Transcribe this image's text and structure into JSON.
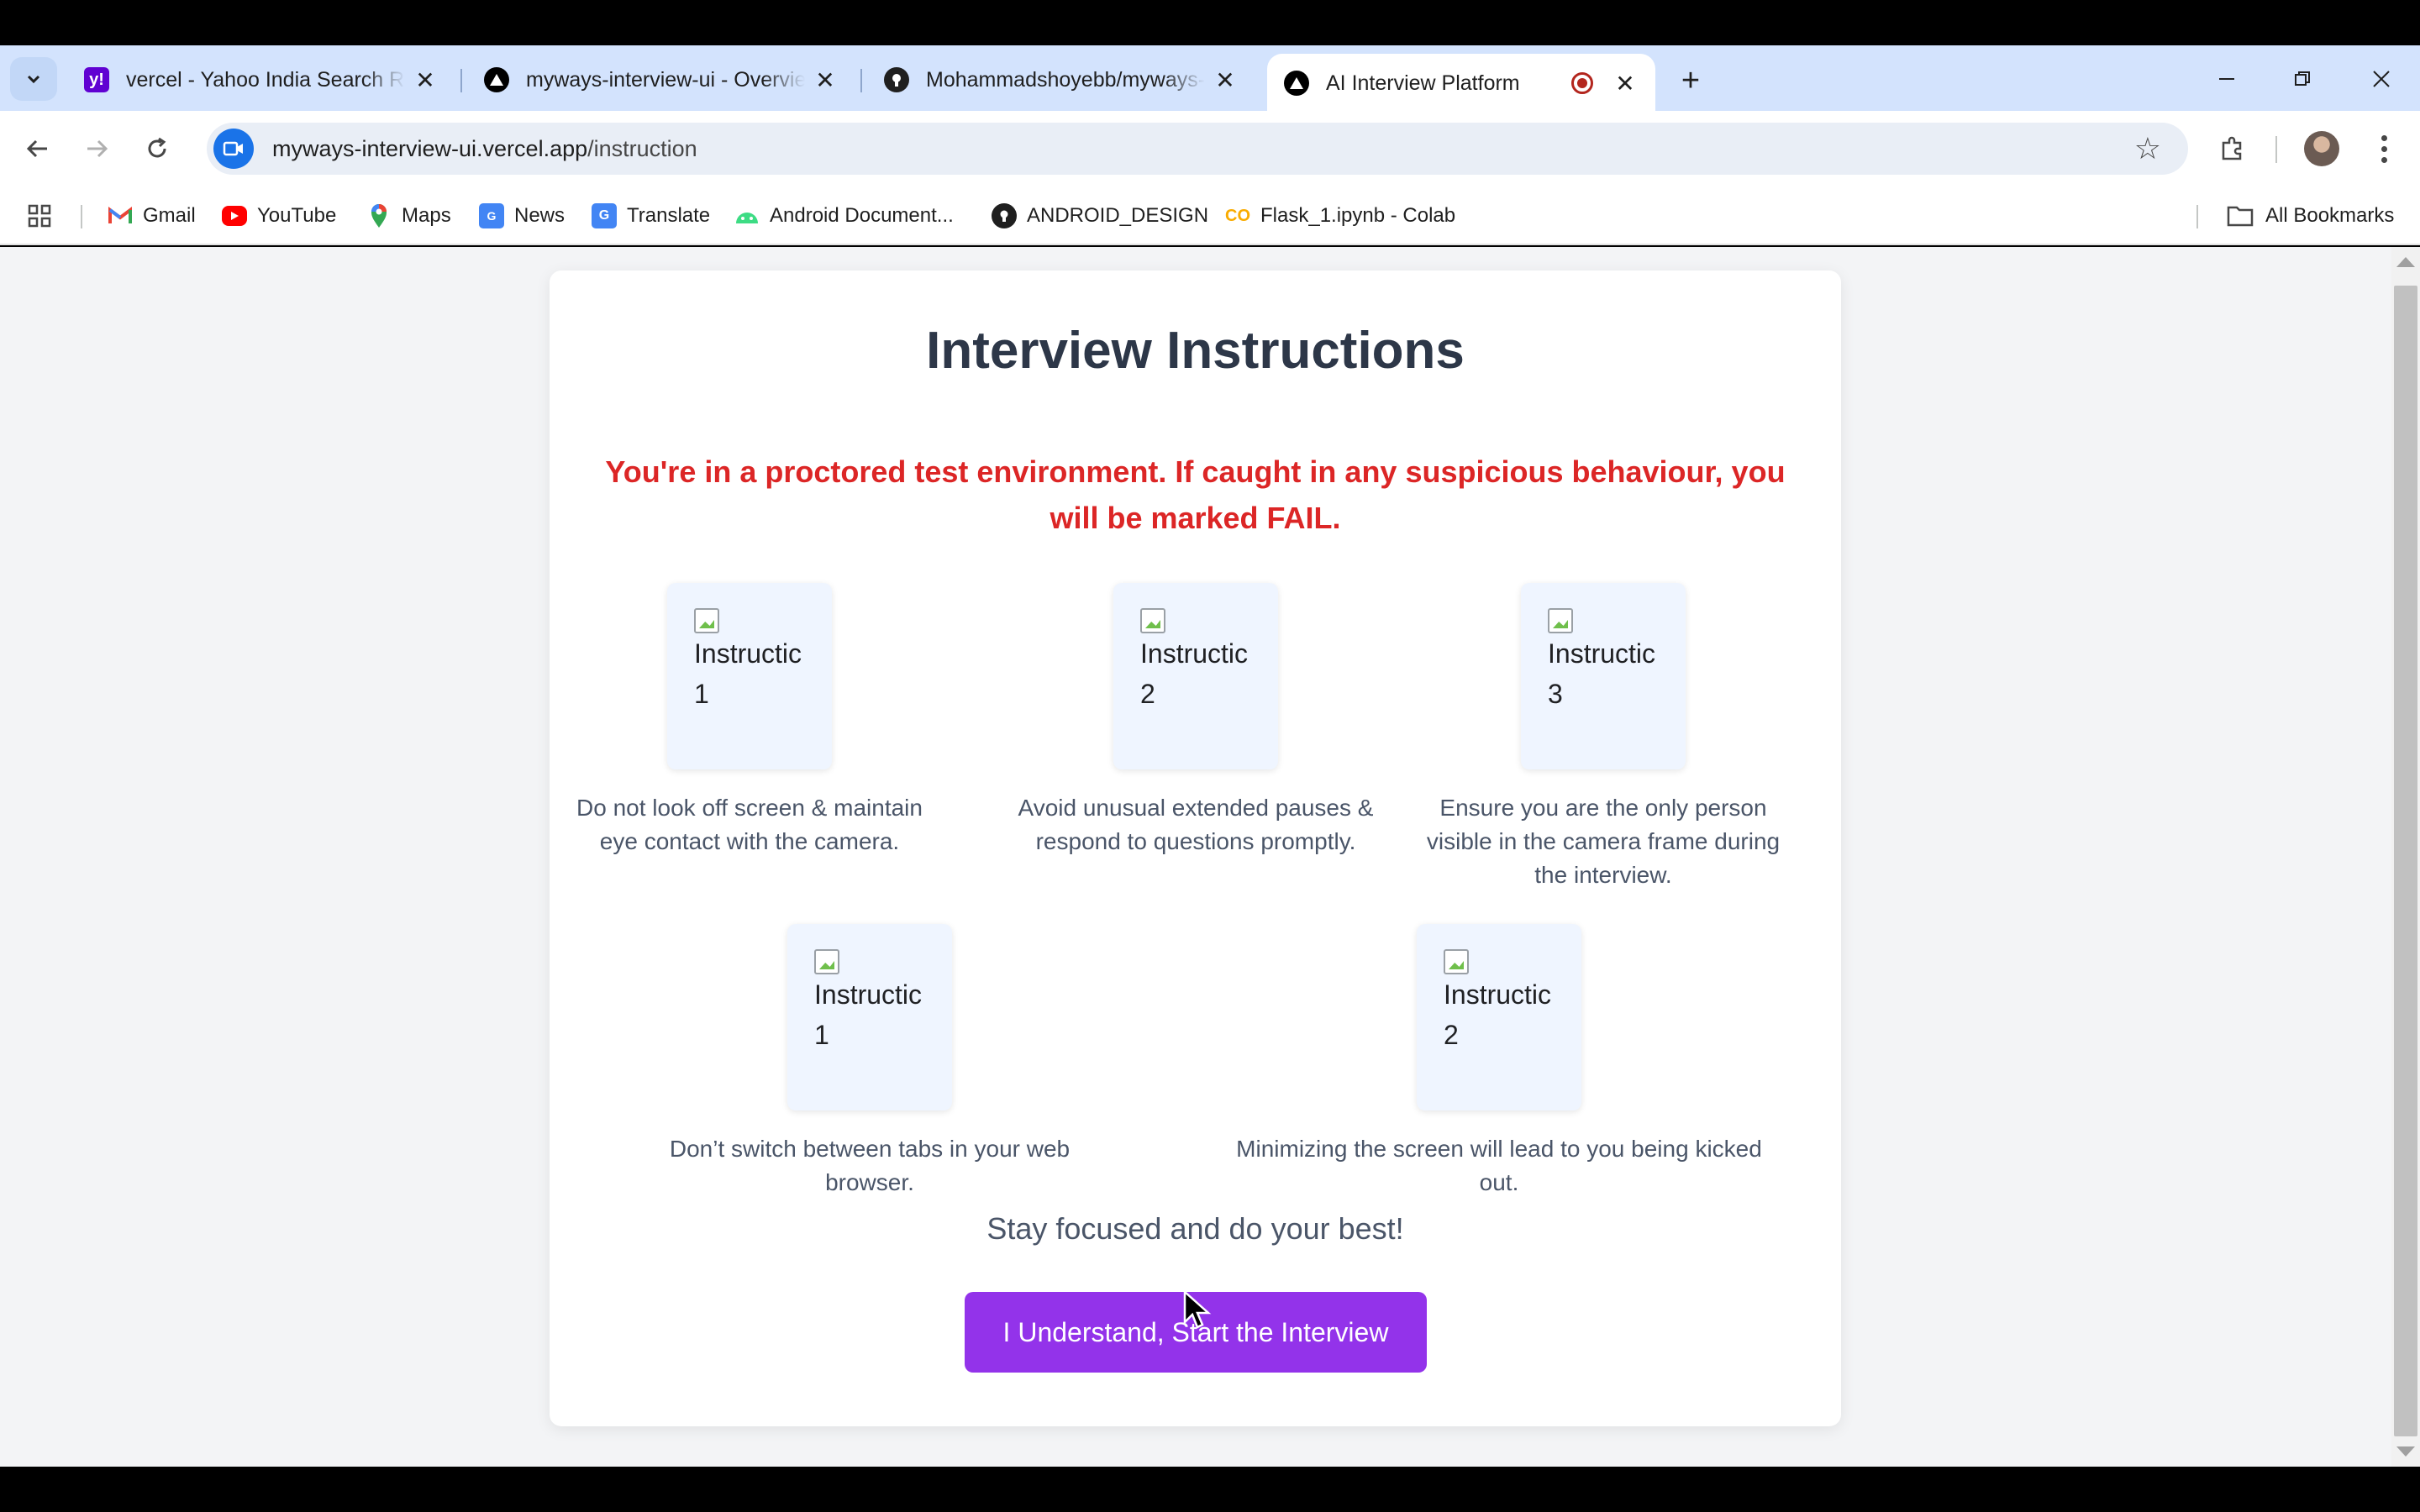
{
  "browser": {
    "tabs": [
      {
        "title": "vercel - Yahoo India Search Results",
        "favicon": "yahoo-icon",
        "color": "#6001d2"
      },
      {
        "title": "myways-interview-ui - Overview",
        "favicon": "vercel-icon",
        "color": "#000000"
      },
      {
        "title": "Mohammadshoyebb/myways-interview-ui",
        "favicon": "github-icon",
        "color": "#1f1f1f"
      },
      {
        "title": "AI Interview Platform",
        "favicon": "vercel-icon",
        "color": "#000000",
        "active": true,
        "recording": true
      }
    ],
    "address": {
      "domain": "myways-interview-ui.vercel.app",
      "path": "/instruction"
    },
    "bookmarks": [
      {
        "label": "Gmail",
        "icon": "gmail-icon"
      },
      {
        "label": "YouTube",
        "icon": "youtube-icon"
      },
      {
        "label": "Maps",
        "icon": "maps-icon"
      },
      {
        "label": "News",
        "icon": "news-icon"
      },
      {
        "label": "Translate",
        "icon": "translate-icon"
      },
      {
        "label": "Android Document...",
        "icon": "android-icon"
      },
      {
        "label": "ANDROID_DESIGN",
        "icon": "github-icon"
      },
      {
        "label": "Flask_1.ipynb - Colab",
        "icon": "colab-icon"
      }
    ],
    "all_bookmarks": "All Bookmarks"
  },
  "page": {
    "heading": "Interview Instructions",
    "warning": "You're in a proctored test environment. If caught in any suspicious behaviour, you will be marked FAIL.",
    "instructions": [
      {
        "alt_line1": "Instructic",
        "alt_line2": "1",
        "caption": "Do not look off screen & maintain eye contact with the camera."
      },
      {
        "alt_line1": "Instructic",
        "alt_line2": "2",
        "caption": "Avoid unusual extended pauses & respond to questions promptly."
      },
      {
        "alt_line1": "Instructic",
        "alt_line2": "3",
        "caption": "Ensure you are the only person visible in the camera frame during the interview."
      },
      {
        "alt_line1": "Instructic",
        "alt_line2": "1",
        "caption": "Don’t switch between tabs in your web browser."
      },
      {
        "alt_line1": "Instructic",
        "alt_line2": "2",
        "caption": "Minimizing the screen will lead to you being kicked out."
      }
    ],
    "motto": "Stay focused and do your best!",
    "start_button": "I Understand, Start the Interview",
    "accent": "#9333ea",
    "warning_color": "#dc2626"
  }
}
